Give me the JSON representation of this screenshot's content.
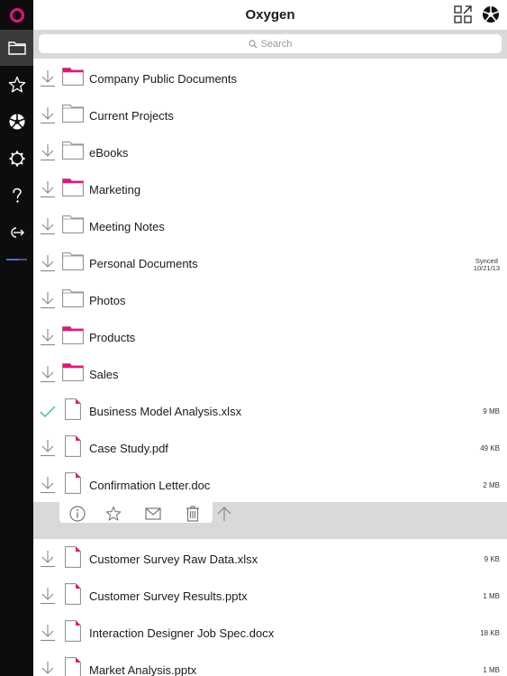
{
  "app": {
    "title": "Oxygen"
  },
  "colors": {
    "brand": "#e3157a",
    "sidebar": "#0d0d0d",
    "accent_check": "#3fb5b0"
  },
  "sidebar": {
    "items": [
      {
        "icon": "folder-icon",
        "active": true
      },
      {
        "icon": "star-icon"
      },
      {
        "icon": "aperture-icon"
      },
      {
        "icon": "gear-icon"
      },
      {
        "icon": "help-icon"
      },
      {
        "icon": "logout-icon"
      }
    ]
  },
  "search": {
    "placeholder": "Search"
  },
  "files": [
    {
      "name": "Company Public Documents",
      "type": "folder",
      "shared": true
    },
    {
      "name": "Current Projects",
      "type": "folder",
      "shared": false
    },
    {
      "name": "eBooks",
      "type": "folder",
      "shared": false
    },
    {
      "name": "Marketing",
      "type": "folder",
      "shared": true
    },
    {
      "name": "Meeting Notes",
      "type": "folder",
      "shared": false
    },
    {
      "name": "Personal Documents",
      "type": "folder",
      "shared": false,
      "sync_label": "Synced",
      "sync_date": "10/21/13"
    },
    {
      "name": "Photos",
      "type": "folder",
      "shared": false
    },
    {
      "name": "Products",
      "type": "folder",
      "shared": true
    },
    {
      "name": "Sales",
      "type": "folder",
      "shared": true
    },
    {
      "name": "Business Model Analysis.xlsx",
      "type": "file",
      "size": "9 MB",
      "downloaded": true
    },
    {
      "name": "Case Study.pdf",
      "type": "file",
      "size": "49 KB"
    },
    {
      "name": "Confirmation Letter.doc",
      "type": "file",
      "size": "2 MB"
    },
    {
      "name": "Customer Survey Raw Data.xlsx",
      "type": "file",
      "size": "9 KB"
    },
    {
      "name": "Customer Survey Results.pptx",
      "type": "file",
      "size": "1 MB"
    },
    {
      "name": "Interaction Designer Job Spec.docx",
      "type": "file",
      "size": "18 KB"
    },
    {
      "name": "Market Analysis.pptx",
      "type": "file",
      "size": "1 MB"
    }
  ],
  "actions": [
    "info-icon",
    "star-icon",
    "mail-icon",
    "trash-icon",
    "share-up-icon"
  ]
}
